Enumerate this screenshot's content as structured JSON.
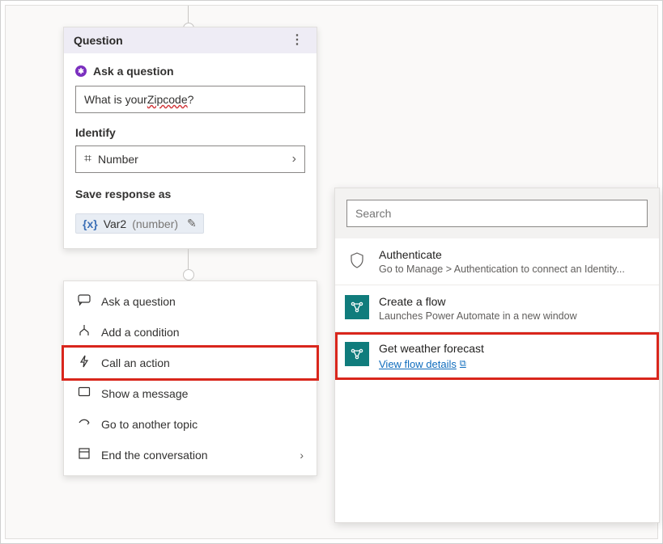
{
  "question_card": {
    "header_title": "Question",
    "ask_label": "Ask a question",
    "question_text_pre": "What is your ",
    "question_text_underlined": "Zipcode",
    "question_text_post": "?",
    "identify_label": "Identify",
    "identify_value": "Number",
    "save_as_label": "Save response as",
    "var_name": "Var2",
    "var_type": "(number)"
  },
  "action_menu": {
    "items": [
      {
        "label": "Ask a question",
        "icon": "chat"
      },
      {
        "label": "Add a condition",
        "icon": "branch"
      },
      {
        "label": "Call an action",
        "icon": "bolt",
        "highlighted": true
      },
      {
        "label": "Show a message",
        "icon": "message"
      },
      {
        "label": "Go to another topic",
        "icon": "goto"
      },
      {
        "label": "End the conversation",
        "icon": "end",
        "chevron": true
      }
    ]
  },
  "action_panel": {
    "search_placeholder": "Search",
    "items": [
      {
        "title": "Authenticate",
        "subtitle": "Go to Manage > Authentication to connect an Identity...",
        "icon": "shield"
      },
      {
        "title": "Create a flow",
        "subtitle": "Launches Power Automate in a new window",
        "icon": "flow"
      },
      {
        "title": "Get weather forecast",
        "link_label": "View flow details",
        "icon": "flow",
        "highlighted": true
      }
    ]
  }
}
